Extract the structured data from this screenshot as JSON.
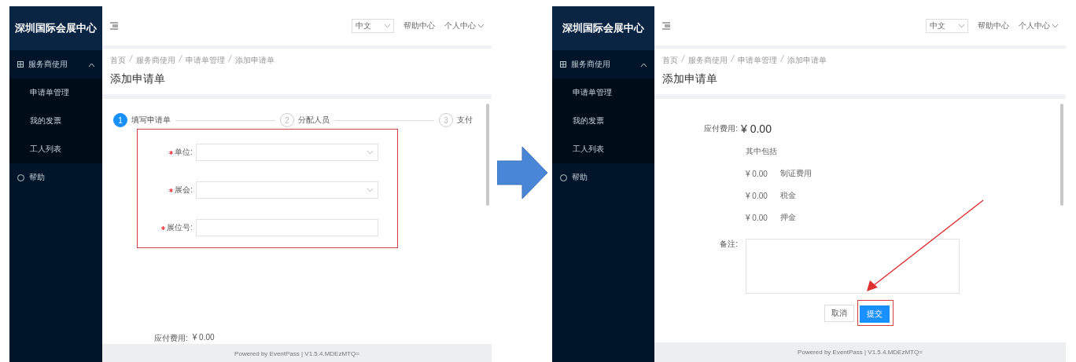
{
  "screens": [
    {
      "kind": "form",
      "app_title": "深圳国际会展中心",
      "language": "中文",
      "help_link": "帮助中心",
      "user_menu": "个人中心",
      "sidebar": {
        "group": {
          "label": "服务商使用",
          "expanded": true,
          "children": [
            {
              "label": "申请单管理"
            },
            {
              "label": "我的发票"
            },
            {
              "label": "工人列表"
            }
          ]
        },
        "items": [
          {
            "label": "帮助"
          }
        ]
      },
      "breadcrumb": [
        "首页",
        "服务商使用",
        "申请单管理",
        "添加申请单"
      ],
      "page_title": "添加申请单",
      "steps": [
        {
          "number": "1",
          "label": "填写申请单",
          "active": true
        },
        {
          "number": "2",
          "label": "分配人员",
          "active": false
        },
        {
          "number": "3",
          "label": "支付",
          "active": false
        }
      ],
      "fields": [
        {
          "label": "单位:",
          "kind": "select",
          "required": true
        },
        {
          "label": "展会:",
          "kind": "select",
          "required": true
        },
        {
          "label": "展位号:",
          "kind": "text",
          "required": true
        }
      ],
      "fee_label": "应付费用:",
      "fee_value": "¥ 0.00",
      "footer": "Powered by EventPass | V1.5.4.MDEzMTQ="
    },
    {
      "kind": "payment",
      "app_title": "深圳国际会展中心",
      "language": "中文",
      "help_link": "帮助中心",
      "user_menu": "个人中心",
      "sidebar": {
        "group": {
          "label": "服务商使用",
          "expanded": true,
          "children": [
            {
              "label": "申请单管理"
            },
            {
              "label": "我的发票"
            },
            {
              "label": "工人列表"
            }
          ]
        },
        "items": [
          {
            "label": "帮助"
          }
        ]
      },
      "breadcrumb": [
        "首页",
        "服务商使用",
        "申请单管理",
        "添加申请单"
      ],
      "page_title": "添加申请单",
      "fee_label": "应付费用:",
      "fee_value": "¥ 0.00",
      "includes_label": "其中包括",
      "fee_items": [
        {
          "amount": "¥ 0.00",
          "name": "制证费用"
        },
        {
          "amount": "¥ 0.00",
          "name": "税金"
        },
        {
          "amount": "¥ 0.00",
          "name": "押金"
        }
      ],
      "remark_label": "备注:",
      "buttons": [
        {
          "label": "取消",
          "primary": false
        },
        {
          "label": "提交",
          "primary": true
        }
      ],
      "footer": "Powered by EventPass | V1.5.4.MDEzMTQ="
    }
  ]
}
